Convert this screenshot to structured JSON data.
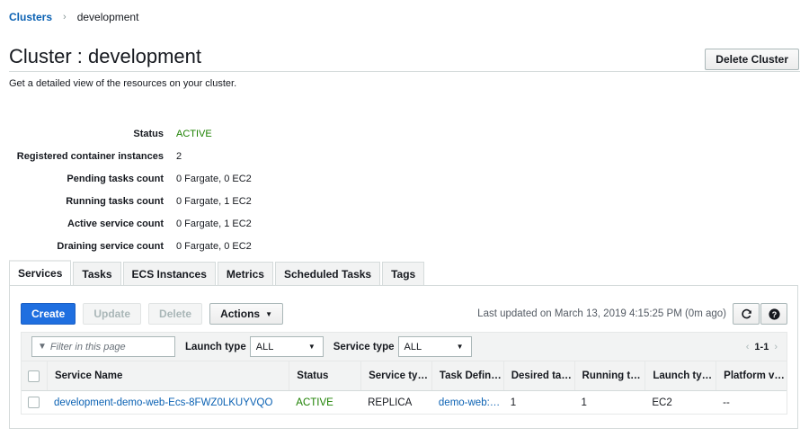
{
  "breadcrumb": {
    "root": "Clusters",
    "separator": "›",
    "current": "development"
  },
  "page": {
    "title": "Cluster : development",
    "description": "Get a detailed view of the resources on your cluster.",
    "delete_cluster_label": "Delete Cluster"
  },
  "details": [
    {
      "label": "Status",
      "value": "ACTIVE"
    },
    {
      "label": "Registered container instances",
      "value": "2"
    },
    {
      "label": "Pending tasks count",
      "value": "0 Fargate, 0 EC2"
    },
    {
      "label": "Running tasks count",
      "value": "0 Fargate, 1 EC2"
    },
    {
      "label": "Active service count",
      "value": "0 Fargate, 1 EC2"
    },
    {
      "label": "Draining service count",
      "value": "0 Fargate, 0 EC2"
    }
  ],
  "tabs": [
    "Services",
    "Tasks",
    "ECS Instances",
    "Metrics",
    "Scheduled Tasks",
    "Tags"
  ],
  "toolbar": {
    "create": "Create",
    "update": "Update",
    "delete": "Delete",
    "actions": "Actions",
    "last_updated": "Last updated on March 13, 2019 4:15:25 PM (0m ago)",
    "refresh_icon": "refresh-icon",
    "help_icon": "help-icon"
  },
  "filters": {
    "placeholder": "Filter in this page",
    "launch_type_label": "Launch type",
    "launch_type_value": "ALL",
    "service_type_label": "Service type",
    "service_type_value": "ALL",
    "page_range": "1-1"
  },
  "table": {
    "columns": [
      "Service Name",
      "Status",
      "Service ty…",
      "Task Defin…",
      "Desired ta…",
      "Running t…",
      "Launch ty…",
      "Platform v…"
    ],
    "rows": [
      {
        "service_name": "development-demo-web-Ecs-8FWZ0LKUYVQO",
        "status": "ACTIVE",
        "service_type": "REPLICA",
        "task_definition": "demo-web:…",
        "desired": "1",
        "running": "1",
        "launch_type": "EC2",
        "platform": "--"
      }
    ]
  },
  "colors": {
    "primary": "#1f6fe0",
    "link": "#0a61b3",
    "active": "#1d8102"
  }
}
